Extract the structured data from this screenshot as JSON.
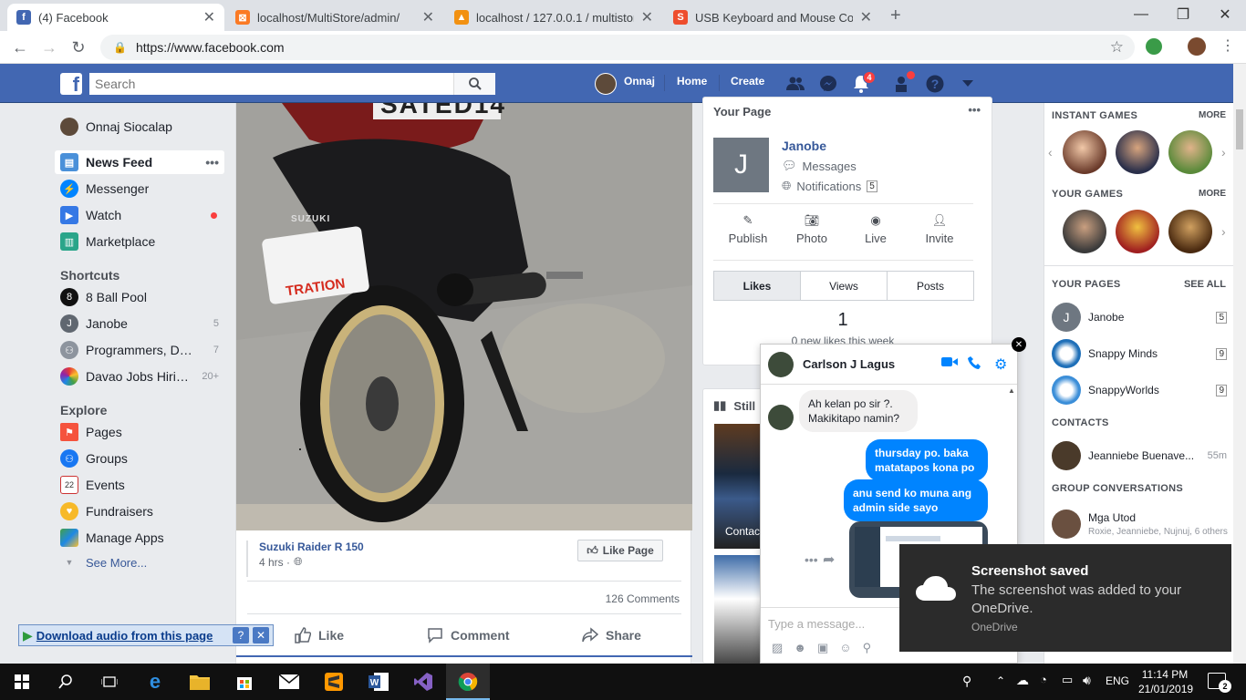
{
  "browser": {
    "tabs": [
      {
        "title": "(4) Facebook",
        "icon": "facebook-icon",
        "color": "#4267b2"
      },
      {
        "title": "localhost/MultiStore/admin/",
        "icon": "xampp-icon",
        "color": "#fb7a24"
      },
      {
        "title": "localhost / 127.0.0.1 / multistore",
        "icon": "phpmyadmin-icon",
        "color": "#f29111"
      },
      {
        "title": "USB Keyboard and Mouse Comb",
        "icon": "shopee-icon",
        "color": "#ee4d2d"
      }
    ],
    "url": "https://www.facebook.com"
  },
  "fb": {
    "search_placeholder": "Search",
    "profile_name": "Onnaj",
    "home": "Home",
    "create": "Create",
    "notif_count": "4",
    "accent": "#4267b2"
  },
  "leftnav": {
    "profile": "Onnaj Siocalap",
    "main": [
      {
        "label": "News Feed",
        "icon": "news-feed-icon"
      },
      {
        "label": "Messenger",
        "icon": "messenger-icon"
      },
      {
        "label": "Watch",
        "icon": "watch-icon"
      },
      {
        "label": "Marketplace",
        "icon": "marketplace-icon"
      }
    ],
    "shortcuts_title": "Shortcuts",
    "shortcuts": [
      {
        "label": "8 Ball Pool",
        "count": ""
      },
      {
        "label": "Janobe",
        "count": "5"
      },
      {
        "label": "Programmers, Dev...",
        "count": "7"
      },
      {
        "label": "Davao Jobs Hiring ...",
        "count": "20+"
      }
    ],
    "explore_title": "Explore",
    "explore": [
      {
        "label": "Pages"
      },
      {
        "label": "Groups"
      },
      {
        "label": "Events"
      },
      {
        "label": "Fundraisers"
      },
      {
        "label": "Manage Apps"
      }
    ],
    "see_more": "See More..."
  },
  "post": {
    "plate_text": "SATED14",
    "brand_text": "SUZUKI",
    "sticker_text": "TRATION",
    "page_name": "Suzuki Raider R 150",
    "time": "4 hrs ·",
    "like_page": "Like Page",
    "comments": "126 Comments",
    "actions": [
      "Like",
      "Comment",
      "Share"
    ]
  },
  "yourpage": {
    "title": "Your Page",
    "name": "Janobe",
    "initial": "J",
    "messages": "Messages",
    "notifications": "Notifications",
    "notif_count": "5",
    "tools": [
      "Publish",
      "Photo",
      "Live",
      "Invite"
    ],
    "tabs": [
      "Likes",
      "Views",
      "Posts"
    ],
    "stat_value": "1",
    "stat_label": "0 new likes this week",
    "still_label": "Still",
    "contact_label": "Contac"
  },
  "chat": {
    "name": "Carlson J Lagus",
    "messages": [
      {
        "from": "them",
        "text": "Ah  kelan po sir ?. Makikitapo namin?"
      },
      {
        "from": "me",
        "text": "thursday po. baka matatapos kona po"
      },
      {
        "from": "me",
        "text": "anu send ko muna ang admin side sayo"
      }
    ],
    "input_placeholder": "Type a message..."
  },
  "sidebar": {
    "instant_games": "INSTANT GAMES",
    "your_games": "YOUR GAMES",
    "more": "MORE",
    "your_pages": "YOUR PAGES",
    "see_all": "SEE ALL",
    "pages": [
      {
        "name": "Janobe",
        "count": "5"
      },
      {
        "name": "Snappy Minds",
        "count": "9"
      },
      {
        "name": "SnappyWorlds",
        "count": "9"
      }
    ],
    "contacts_title": "CONTACTS",
    "contacts": [
      {
        "name": "Jeanniebe Buenave...",
        "time": "55m"
      }
    ],
    "group_title": "GROUP CONVERSATIONS",
    "groups": [
      {
        "name": "Mga Utod",
        "members": "Roxie, Jeanniebe, Nujnuj, 6 others"
      }
    ]
  },
  "toast": {
    "title": "Screenshot saved",
    "body": "The screenshot was added to your OneDrive.",
    "source": "OneDrive"
  },
  "download_bar": {
    "label": "Download audio from this page"
  },
  "taskbar": {
    "time": "11:14 PM",
    "date": "21/01/2019",
    "lang": "ENG",
    "notif_count": "2"
  }
}
